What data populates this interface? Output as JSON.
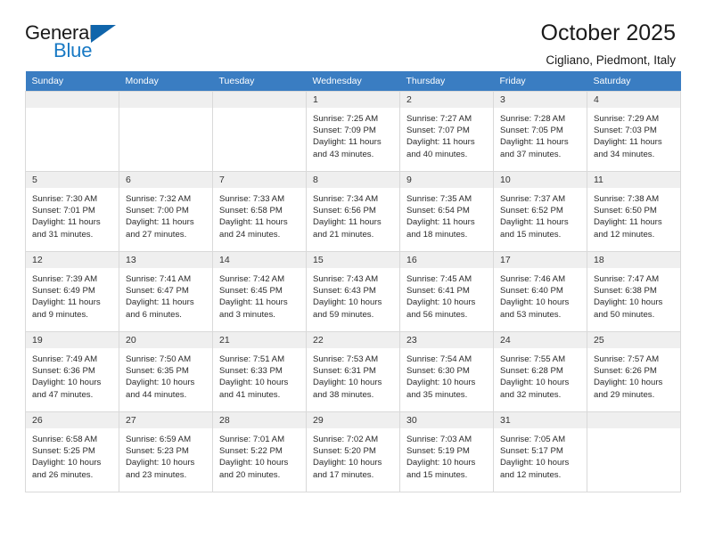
{
  "brand": {
    "name_top": "General",
    "name_bottom": "Blue",
    "triangle_color": "#1065ab",
    "blue_text_color": "#1879c4"
  },
  "header": {
    "title": "October 2025",
    "subtitle": "Cigliano, Piedmont, Italy"
  },
  "theme": {
    "header_row_bg": "#3a7dc2",
    "header_row_text": "#ffffff",
    "daynum_bg": "#efefef",
    "grid_line": "#d9d9d9"
  },
  "weekday_headers": [
    "Sunday",
    "Monday",
    "Tuesday",
    "Wednesday",
    "Thursday",
    "Friday",
    "Saturday"
  ],
  "labels": {
    "sunrise_prefix": "Sunrise: ",
    "sunset_prefix": "Sunset: ",
    "daylight_prefix": "Daylight: "
  },
  "weeks": [
    [
      {
        "empty": true
      },
      {
        "empty": true
      },
      {
        "empty": true
      },
      {
        "day": "1",
        "sunrise": "Sunrise: 7:25 AM",
        "sunset": "Sunset: 7:09 PM",
        "daylight": "Daylight: 11 hours and 43 minutes."
      },
      {
        "day": "2",
        "sunrise": "Sunrise: 7:27 AM",
        "sunset": "Sunset: 7:07 PM",
        "daylight": "Daylight: 11 hours and 40 minutes."
      },
      {
        "day": "3",
        "sunrise": "Sunrise: 7:28 AM",
        "sunset": "Sunset: 7:05 PM",
        "daylight": "Daylight: 11 hours and 37 minutes."
      },
      {
        "day": "4",
        "sunrise": "Sunrise: 7:29 AM",
        "sunset": "Sunset: 7:03 PM",
        "daylight": "Daylight: 11 hours and 34 minutes."
      }
    ],
    [
      {
        "day": "5",
        "sunrise": "Sunrise: 7:30 AM",
        "sunset": "Sunset: 7:01 PM",
        "daylight": "Daylight: 11 hours and 31 minutes."
      },
      {
        "day": "6",
        "sunrise": "Sunrise: 7:32 AM",
        "sunset": "Sunset: 7:00 PM",
        "daylight": "Daylight: 11 hours and 27 minutes."
      },
      {
        "day": "7",
        "sunrise": "Sunrise: 7:33 AM",
        "sunset": "Sunset: 6:58 PM",
        "daylight": "Daylight: 11 hours and 24 minutes."
      },
      {
        "day": "8",
        "sunrise": "Sunrise: 7:34 AM",
        "sunset": "Sunset: 6:56 PM",
        "daylight": "Daylight: 11 hours and 21 minutes."
      },
      {
        "day": "9",
        "sunrise": "Sunrise: 7:35 AM",
        "sunset": "Sunset: 6:54 PM",
        "daylight": "Daylight: 11 hours and 18 minutes."
      },
      {
        "day": "10",
        "sunrise": "Sunrise: 7:37 AM",
        "sunset": "Sunset: 6:52 PM",
        "daylight": "Daylight: 11 hours and 15 minutes."
      },
      {
        "day": "11",
        "sunrise": "Sunrise: 7:38 AM",
        "sunset": "Sunset: 6:50 PM",
        "daylight": "Daylight: 11 hours and 12 minutes."
      }
    ],
    [
      {
        "day": "12",
        "sunrise": "Sunrise: 7:39 AM",
        "sunset": "Sunset: 6:49 PM",
        "daylight": "Daylight: 11 hours and 9 minutes."
      },
      {
        "day": "13",
        "sunrise": "Sunrise: 7:41 AM",
        "sunset": "Sunset: 6:47 PM",
        "daylight": "Daylight: 11 hours and 6 minutes."
      },
      {
        "day": "14",
        "sunrise": "Sunrise: 7:42 AM",
        "sunset": "Sunset: 6:45 PM",
        "daylight": "Daylight: 11 hours and 3 minutes."
      },
      {
        "day": "15",
        "sunrise": "Sunrise: 7:43 AM",
        "sunset": "Sunset: 6:43 PM",
        "daylight": "Daylight: 10 hours and 59 minutes."
      },
      {
        "day": "16",
        "sunrise": "Sunrise: 7:45 AM",
        "sunset": "Sunset: 6:41 PM",
        "daylight": "Daylight: 10 hours and 56 minutes."
      },
      {
        "day": "17",
        "sunrise": "Sunrise: 7:46 AM",
        "sunset": "Sunset: 6:40 PM",
        "daylight": "Daylight: 10 hours and 53 minutes."
      },
      {
        "day": "18",
        "sunrise": "Sunrise: 7:47 AM",
        "sunset": "Sunset: 6:38 PM",
        "daylight": "Daylight: 10 hours and 50 minutes."
      }
    ],
    [
      {
        "day": "19",
        "sunrise": "Sunrise: 7:49 AM",
        "sunset": "Sunset: 6:36 PM",
        "daylight": "Daylight: 10 hours and 47 minutes."
      },
      {
        "day": "20",
        "sunrise": "Sunrise: 7:50 AM",
        "sunset": "Sunset: 6:35 PM",
        "daylight": "Daylight: 10 hours and 44 minutes."
      },
      {
        "day": "21",
        "sunrise": "Sunrise: 7:51 AM",
        "sunset": "Sunset: 6:33 PM",
        "daylight": "Daylight: 10 hours and 41 minutes."
      },
      {
        "day": "22",
        "sunrise": "Sunrise: 7:53 AM",
        "sunset": "Sunset: 6:31 PM",
        "daylight": "Daylight: 10 hours and 38 minutes."
      },
      {
        "day": "23",
        "sunrise": "Sunrise: 7:54 AM",
        "sunset": "Sunset: 6:30 PM",
        "daylight": "Daylight: 10 hours and 35 minutes."
      },
      {
        "day": "24",
        "sunrise": "Sunrise: 7:55 AM",
        "sunset": "Sunset: 6:28 PM",
        "daylight": "Daylight: 10 hours and 32 minutes."
      },
      {
        "day": "25",
        "sunrise": "Sunrise: 7:57 AM",
        "sunset": "Sunset: 6:26 PM",
        "daylight": "Daylight: 10 hours and 29 minutes."
      }
    ],
    [
      {
        "day": "26",
        "sunrise": "Sunrise: 6:58 AM",
        "sunset": "Sunset: 5:25 PM",
        "daylight": "Daylight: 10 hours and 26 minutes."
      },
      {
        "day": "27",
        "sunrise": "Sunrise: 6:59 AM",
        "sunset": "Sunset: 5:23 PM",
        "daylight": "Daylight: 10 hours and 23 minutes."
      },
      {
        "day": "28",
        "sunrise": "Sunrise: 7:01 AM",
        "sunset": "Sunset: 5:22 PM",
        "daylight": "Daylight: 10 hours and 20 minutes."
      },
      {
        "day": "29",
        "sunrise": "Sunrise: 7:02 AM",
        "sunset": "Sunset: 5:20 PM",
        "daylight": "Daylight: 10 hours and 17 minutes."
      },
      {
        "day": "30",
        "sunrise": "Sunrise: 7:03 AM",
        "sunset": "Sunset: 5:19 PM",
        "daylight": "Daylight: 10 hours and 15 minutes."
      },
      {
        "day": "31",
        "sunrise": "Sunrise: 7:05 AM",
        "sunset": "Sunset: 5:17 PM",
        "daylight": "Daylight: 10 hours and 12 minutes."
      },
      {
        "empty": true
      }
    ]
  ]
}
